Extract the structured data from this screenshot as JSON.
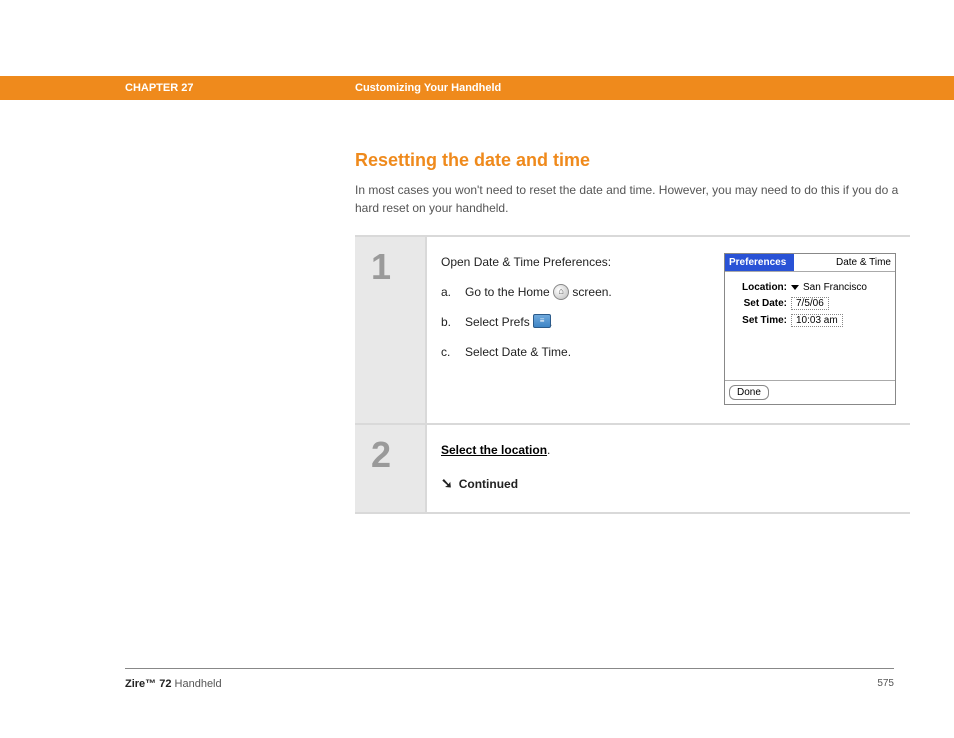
{
  "header": {
    "chapter": "CHAPTER 27",
    "title": "Customizing Your Handheld"
  },
  "section": {
    "heading": "Resetting the date and time",
    "intro": "In most cases you won't need to reset the date and time. However, you may need to do this if you do a hard reset on your handheld."
  },
  "steps": [
    {
      "number": "1",
      "lead": "Open Date & Time Preferences:",
      "subs": {
        "a_pre": "Go to the Home",
        "a_post": "screen.",
        "b_pre": "Select Prefs",
        "b_post": ".",
        "c": "Select Date & Time."
      },
      "screenshot": {
        "title_left": "Preferences",
        "title_right": "Date & Time",
        "location_label": "Location:",
        "location_value": "San Francisco",
        "date_label": "Set Date:",
        "date_value": "7/5/06",
        "time_label": "Set Time:",
        "time_value": "10:03 am",
        "done": "Done"
      }
    },
    {
      "number": "2",
      "link": "Select the location",
      "period": ".",
      "continued": "Continued"
    }
  ],
  "footer": {
    "brand": "Zire™ 72",
    "product": " Handheld",
    "page": "575"
  }
}
